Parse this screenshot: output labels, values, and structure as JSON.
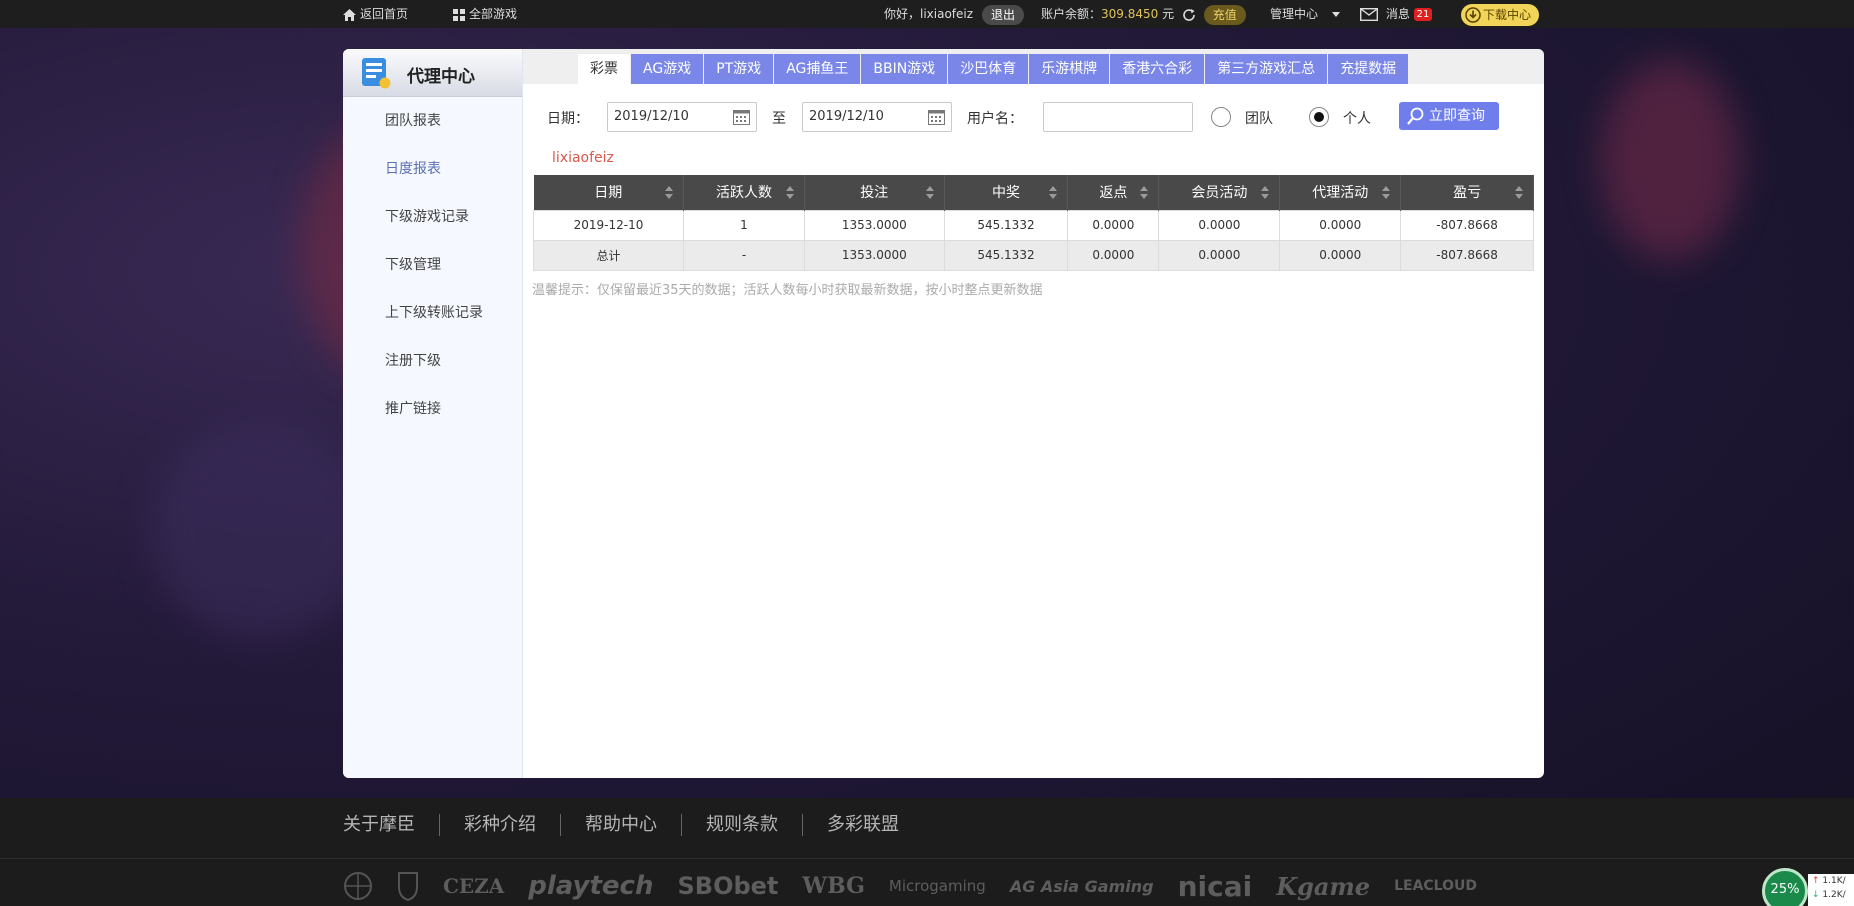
{
  "topbar": {
    "home": "返回首页",
    "all_games": "全部游戏",
    "greeting": "你好，lixiaofeiz",
    "logout": "退出",
    "balance_label": "账户余额：",
    "balance_value": "309.8450",
    "balance_unit": "元",
    "recharge": "充值",
    "manage": "管理中心",
    "messages": "消息",
    "messages_count": "21",
    "download": "下载中心"
  },
  "sidebar": {
    "title": "代理中心",
    "items": [
      {
        "label": "团队报表"
      },
      {
        "label": "日度报表"
      },
      {
        "label": "下级游戏记录"
      },
      {
        "label": "下级管理"
      },
      {
        "label": "上下级转账记录"
      },
      {
        "label": "注册下级"
      },
      {
        "label": "推广链接"
      }
    ]
  },
  "tabs": [
    "彩票",
    "AG游戏",
    "PT游戏",
    "AG捕鱼王",
    "BBIN游戏",
    "沙巴体育",
    "乐游棋牌",
    "香港六合彩",
    "第三方游戏汇总",
    "充提数据"
  ],
  "filters": {
    "date_label": "日期：",
    "date_from": "2019/12/10",
    "to_label": "至",
    "date_to": "2019/12/10",
    "username_label": "用户名：",
    "username_value": "",
    "team_label": "团队",
    "personal_label": "个人",
    "query_button": "立即查询"
  },
  "report": {
    "username": "lixiaofeiz",
    "columns": [
      "日期",
      "活跃人数",
      "投注",
      "中奖",
      "返点",
      "会员活动",
      "代理活动",
      "盈亏"
    ],
    "rows": [
      [
        "2019-12-10",
        "1",
        "1353.0000",
        "545.1332",
        "0.0000",
        "0.0000",
        "0.0000",
        "-807.8668"
      ]
    ],
    "total": [
      "总计",
      "-",
      "1353.0000",
      "545.1332",
      "0.0000",
      "0.0000",
      "0.0000",
      "-807.8668"
    ],
    "tip": "温馨提示：仅保留最近35天的数据；活跃人数每小时获取最新数据，按小时整点更新数据"
  },
  "footer": {
    "links": [
      "关于摩臣",
      "彩种介绍",
      "帮助中心",
      "规则条款",
      "多彩联盟"
    ],
    "partner_logos": [
      "CEZA",
      "playtech",
      "SBObet",
      "WBG",
      "Microgaming",
      "AG Asia Gaming",
      "nicai",
      "Kgame",
      "LEACLOUD"
    ]
  },
  "network_widget": {
    "percent": "25%",
    "up": "1.1K/",
    "down": "1.2K/"
  }
}
